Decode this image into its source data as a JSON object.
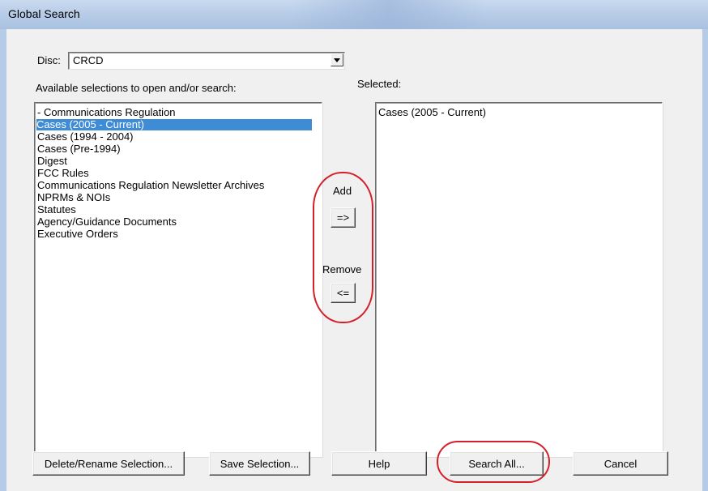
{
  "window": {
    "title": "Global Search"
  },
  "disc": {
    "label": "Disc:",
    "value": "CRCD"
  },
  "available": {
    "label": "Available selections to open and/or search:",
    "items": [
      "- Communications Regulation",
      "Cases (2005 - Current)",
      "Cases (1994 - 2004)",
      "Cases (Pre-1994)",
      "Digest",
      "FCC Rules",
      "Communications Regulation Newsletter Archives",
      "NPRMs & NOIs",
      "Statutes",
      "Agency/Guidance Documents",
      "Executive Orders"
    ],
    "selected_index": 1
  },
  "selected": {
    "label": "Selected:",
    "items": [
      "Cases (2005 - Current)"
    ]
  },
  "transfer": {
    "add_label": "Add",
    "add_button": "=>",
    "remove_label": "Remove",
    "remove_button": "<="
  },
  "buttons": {
    "delete_rename": "Delete/Rename Selection...",
    "save_selection": "Save Selection...",
    "help": "Help",
    "search_all": "Search All...",
    "cancel": "Cancel"
  },
  "colors": {
    "selection_highlight": "#3e8cd6",
    "annotation": "#d4202a",
    "dialog_background": "#f0f0f0"
  }
}
